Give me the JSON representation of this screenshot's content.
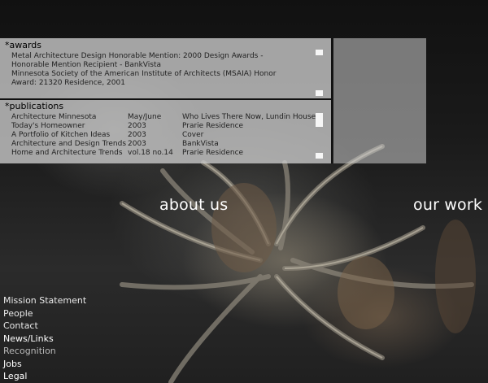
{
  "awards": {
    "title": "*awards",
    "lines": [
      "Metal Architecture Design Honorable Mention: 2000 Design Awards - Honorable Mention Recipient  - BankVista",
      "Minnesota Society of the American Institute of Architects (MSAIA) Honor Award: 21320 Residence, 2001"
    ]
  },
  "publications": {
    "title": "*publications",
    "rows": [
      {
        "name": "Architecture Minnesota",
        "date": "May/June",
        "subject": "Who Lives There Now, Lundin House"
      },
      {
        "name": "Today's Homeowner",
        "date": "2003",
        "subject": "Prarie Residence"
      },
      {
        "name": "A Portfolio of Kitchen Ideas",
        "date": "2003",
        "subject": "Cover"
      },
      {
        "name": "Architecture and Design Trends",
        "date": "2003",
        "subject": "BankVista"
      },
      {
        "name": "Home and Architecture Trends",
        "date": "vol.18 no.14",
        "subject": "Prarie Residence"
      }
    ]
  },
  "nav": {
    "about": "about us",
    "work": "our work"
  },
  "side_menu": [
    "Mission Statement",
    "People",
    "Contact",
    "News/Links",
    "Recognition",
    "Jobs",
    "Legal"
  ]
}
